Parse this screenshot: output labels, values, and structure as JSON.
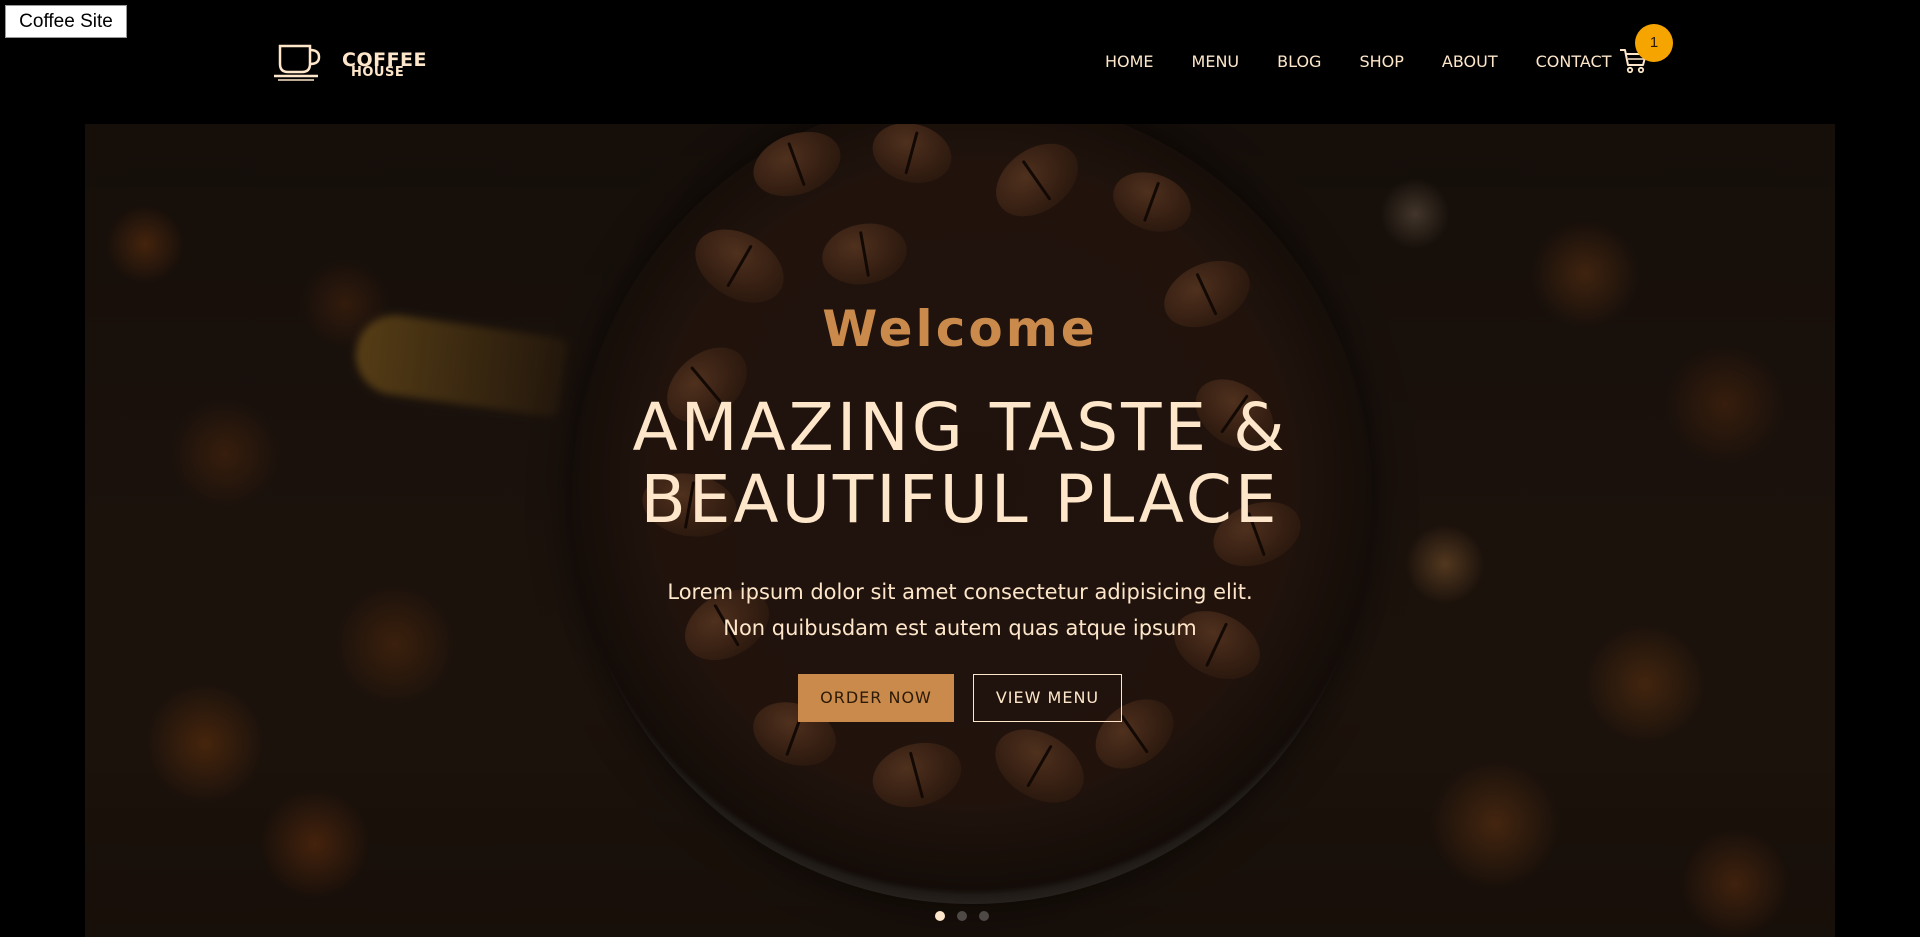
{
  "tab": {
    "title": "Coffee Site"
  },
  "header": {
    "logo_line1": "COFFEE",
    "logo_line2": "HOUSE",
    "nav": [
      "HOME",
      "MENU",
      "BLOG",
      "SHOP",
      "ABOUT",
      "CONTACT"
    ],
    "cart_count": "1",
    "cart_icon": "cart-icon"
  },
  "hero": {
    "welcome": "Welcome",
    "headline_line1": "AMAZING TASTE &",
    "headline_line2": "BEAUTIFUL PLACE",
    "description": "Lorem ipsum dolor sit amet consectetur adipisicing elit. Non quibusdam est autem quas atque ipsum",
    "order_button": "ORDER NOW",
    "menu_button": "VIEW MENU",
    "slides": {
      "count": 3,
      "active": 1
    }
  },
  "colors": {
    "accent": "#c98a4b",
    "cream": "#fde6c9",
    "badge": "#f6a400",
    "background": "#000000"
  }
}
